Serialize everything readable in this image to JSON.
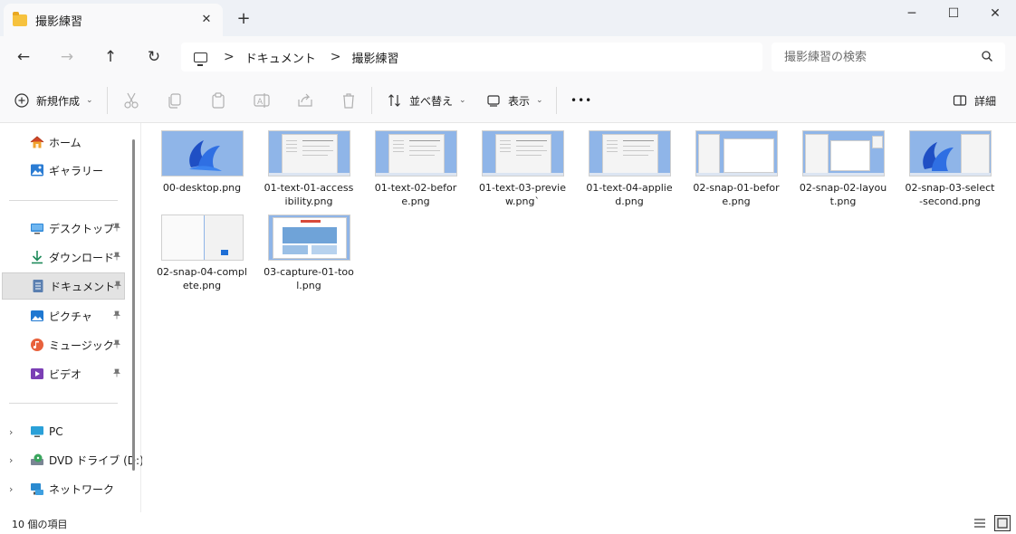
{
  "window": {
    "tab_title": "撮影練習",
    "tab_close_glyph": "✕",
    "new_tab_glyph": "+",
    "minimize_glyph": "─",
    "maximize_glyph": "☐",
    "close_glyph": "✕"
  },
  "nav": {
    "back_glyph": "←",
    "forward_glyph": "→",
    "up_glyph": "↑",
    "refresh_glyph": "↻",
    "breadcrumbs": [
      "ドキュメント",
      "撮影練習"
    ],
    "separator": ">",
    "search_placeholder": "撮影練習の検索"
  },
  "commands": {
    "new_label": "新規作成",
    "sort_label": "並べ替え",
    "view_label": "表示",
    "more_label": "•••",
    "details_label": "詳細",
    "chevron": "⌄"
  },
  "sidebar": {
    "quick": [
      {
        "label": "ホーム",
        "icon": "home-icon"
      },
      {
        "label": "ギャラリー",
        "icon": "gallery-icon"
      }
    ],
    "pinned": [
      {
        "label": "デスクトップ",
        "icon": "desktop-icon"
      },
      {
        "label": "ダウンロード",
        "icon": "download-icon"
      },
      {
        "label": "ドキュメント",
        "icon": "documents-icon",
        "selected": true
      },
      {
        "label": "ピクチャ",
        "icon": "pictures-icon"
      },
      {
        "label": "ミュージック",
        "icon": "music-icon"
      },
      {
        "label": "ビデオ",
        "icon": "video-icon"
      }
    ],
    "pin_glyph": "📌",
    "drives": [
      {
        "label": "PC",
        "icon": "pc-icon"
      },
      {
        "label": "DVD ドライブ (D:)",
        "icon": "dvd-drive-icon"
      },
      {
        "label": "ネットワーク",
        "icon": "network-icon"
      }
    ],
    "expand_glyph": "›"
  },
  "files": [
    {
      "name": "00-desktop.png",
      "thumb": "desktop"
    },
    {
      "name": "01-text-01-accessibility.png",
      "thumb": "settings"
    },
    {
      "name": "01-text-02-before.png",
      "thumb": "settings"
    },
    {
      "name": "01-text-03-preview.png`",
      "thumb": "settings"
    },
    {
      "name": "01-text-04-applied.png",
      "thumb": "settings"
    },
    {
      "name": "02-snap-01-before.png",
      "thumb": "snap"
    },
    {
      "name": "02-snap-02-layout.png",
      "thumb": "snap2"
    },
    {
      "name": "02-snap-03-select-second.png",
      "thumb": "snap3"
    },
    {
      "name": "02-snap-04-complete.png",
      "thumb": "complete"
    },
    {
      "name": "03-capture-01-tool.png",
      "thumb": "capture"
    }
  ],
  "status": {
    "item_count": "10 個の項目"
  },
  "colors": {
    "accent": "#0067c0",
    "folder": "#f6c23e",
    "wallpaper": "#8fb5e8"
  }
}
